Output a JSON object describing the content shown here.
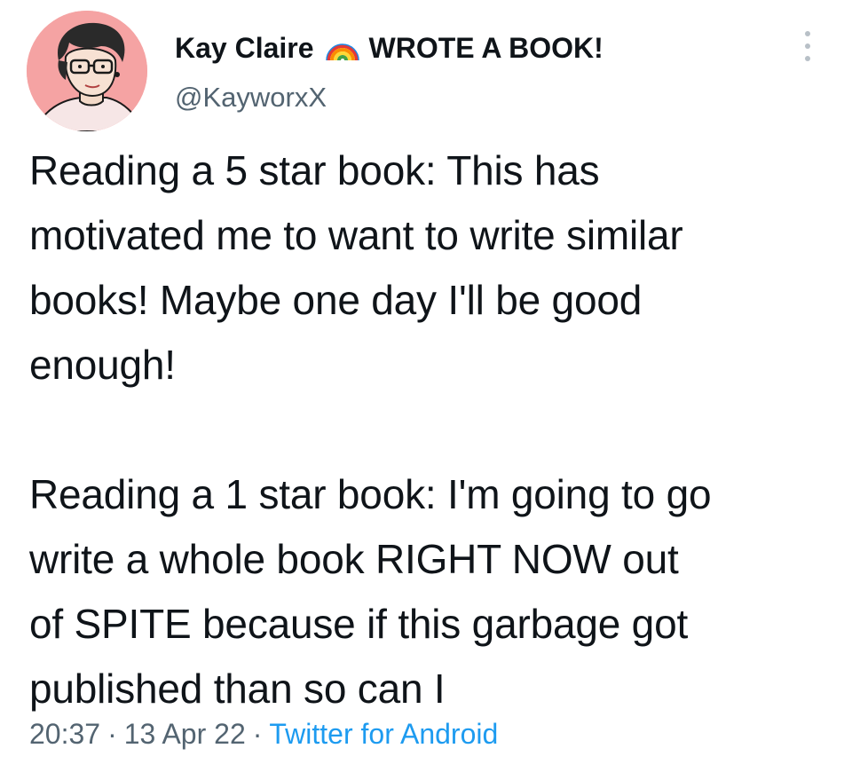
{
  "author": {
    "display_name": "Kay Claire",
    "name_suffix": "WROTE A BOOK!",
    "handle": "@KayworxX",
    "avatar_icon": "cartoon-person-with-glasses",
    "avatar_bg_color": "#f5a3a3",
    "name_emoji_icon": "rainbow-icon"
  },
  "menu_icon": "more-vertical-icon",
  "tweet": {
    "lines": [
      "Reading a 5 star book: This has",
      "motivated me to want to write similar",
      "books! Maybe one day I'll be good",
      "enough!",
      "Reading a 1 star book: I'm going to go",
      "write a whole book RIGHT NOW out",
      "of SPITE because if this garbage got",
      "published than so can I"
    ]
  },
  "meta": {
    "time": "20:37",
    "separator": "·",
    "date": "13 Apr 22",
    "source": "Twitter for Android"
  },
  "colors": {
    "text_primary": "#0f1419",
    "text_secondary": "#536471",
    "link": "#1d9bf0"
  }
}
